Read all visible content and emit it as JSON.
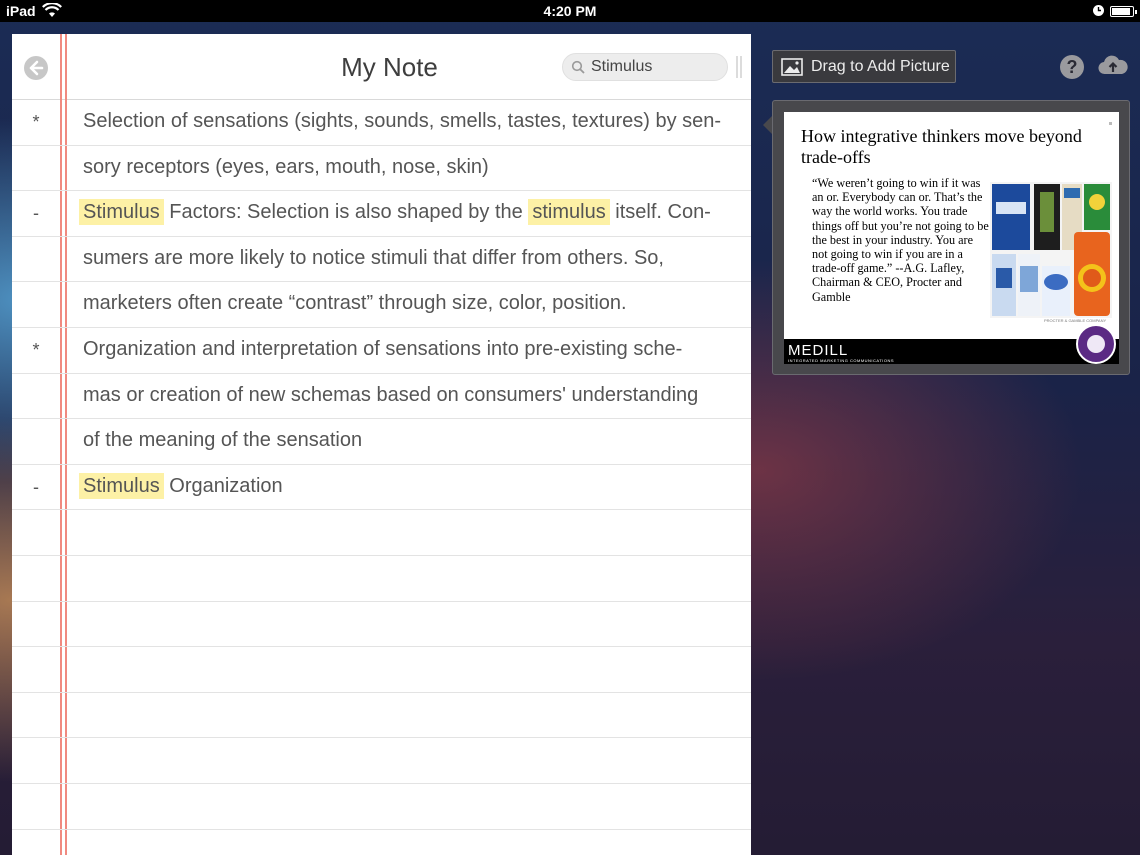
{
  "status_bar": {
    "device": "iPad",
    "time": "4:20 PM"
  },
  "note": {
    "title": "My Note",
    "search_value": "Stimulus",
    "search_placeholder": "Search",
    "rows": [
      {
        "bullet": "*",
        "parts": [
          {
            "text": "Selection of sensations (sights, sounds, smells, tastes, textures) by sen-",
            "hl": false
          }
        ]
      },
      {
        "bullet": "",
        "parts": [
          {
            "text": "sory receptors (eyes, ears, mouth, nose, skin)",
            "hl": false
          }
        ]
      },
      {
        "bullet": "-",
        "parts": [
          {
            "text": "Stimulus",
            "hl": true
          },
          {
            "text": " Factors: Selection is also shaped by the ",
            "hl": false
          },
          {
            "text": "stimulus",
            "hl": true
          },
          {
            "text": " itself. Con-",
            "hl": false
          }
        ]
      },
      {
        "bullet": "",
        "parts": [
          {
            "text": "sumers are more likely to notice stimuli that differ from others. So,",
            "hl": false
          }
        ]
      },
      {
        "bullet": "",
        "parts": [
          {
            "text": "marketers often create “contrast” through size, color, position.",
            "hl": false
          }
        ]
      },
      {
        "bullet": "*",
        "parts": [
          {
            "text": "Organization and interpretation of sensations into pre-existing sche-",
            "hl": false
          }
        ]
      },
      {
        "bullet": "",
        "parts": [
          {
            "text": "mas or creation of new schemas based on consumers' understanding",
            "hl": false
          }
        ]
      },
      {
        "bullet": "",
        "parts": [
          {
            "text": "of the meaning of the sensation",
            "hl": false
          }
        ]
      },
      {
        "bullet": "-",
        "parts": [
          {
            "text": "Stimulus",
            "hl": true
          },
          {
            "text": " Organization",
            "hl": false
          }
        ]
      },
      {
        "bullet": "",
        "parts": []
      },
      {
        "bullet": "",
        "parts": []
      },
      {
        "bullet": "",
        "parts": []
      },
      {
        "bullet": "",
        "parts": []
      },
      {
        "bullet": "",
        "parts": []
      },
      {
        "bullet": "",
        "parts": []
      },
      {
        "bullet": "",
        "parts": []
      }
    ]
  },
  "toolbar": {
    "drag_label": "Drag to Add Picture",
    "help_icon": "help-icon",
    "cloud_icon": "cloud-upload-icon"
  },
  "slide": {
    "title": "How integrative thinkers move beyond trade-offs",
    "quote": "“We weren’t going to win if it was an or.  Everybody can or.  That’s the way the world works.  You trade things off but you’re not going to be the best in your industry.  You are not going to win if you are in a trade-off game.” --A.G. Lafley, Chairman & CEO, Procter and Gamble",
    "logo": "MEDILL",
    "logo_sub": "INTEGRATED MARKETING COMMUNICATIONS",
    "credit": "PROCTER & GAMBLE COMPANY"
  },
  "colors": {
    "highlight": "#fdf1a6",
    "margin_line": "#f08a80",
    "seal": "#5b2a84"
  }
}
